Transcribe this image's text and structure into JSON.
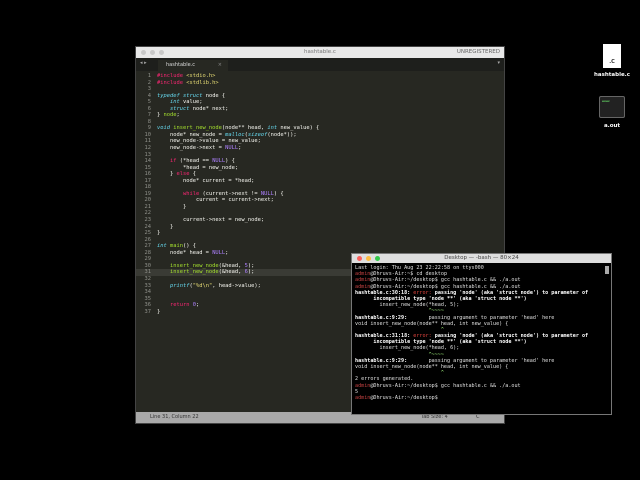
{
  "editor": {
    "title": "hashtable.c",
    "unregistered": "UNREGISTERED",
    "tab_label": "hashtable.c",
    "tab_close": "×",
    "nav": "◂ ▸",
    "tab_menu": "▾",
    "current_line": 31,
    "lines": [
      "#include <stdio.h>",
      "#include <stdlib.h>",
      "",
      "typedef struct node {",
      "    int value;",
      "    struct node* next;",
      "} node;",
      "",
      "void insert_new_node(node** head, int new_value) {",
      "    node* new_node = malloc(sizeof(node*));",
      "    new_node->value = new_value;",
      "    new_node->next = NULL;",
      "",
      "    if (*head == NULL) {",
      "        *head = new_node;",
      "    } else {",
      "        node* current = *head;",
      "",
      "        while (current->next != NULL) {",
      "            current = current->next;",
      "        }",
      "",
      "        current->next = new_node;",
      "    }",
      "}",
      "",
      "int main() {",
      "    node* head = NULL;",
      "",
      "    insert_new_node(&head, 5);",
      "    insert_new_node(&head, 6);",
      "",
      "    printf(\"%d\\n\", head->value);",
      "",
      "",
      "    return 0;",
      "}"
    ],
    "status": {
      "position": "Line 31, Column 22",
      "tab_size": "Tab Size: 4",
      "language": "C"
    }
  },
  "terminal": {
    "title": "Desktop — -bash — 80×24",
    "lines": [
      [
        [
          "",
          "Last login: Thu Aug 23 22:22:58 on ttys000"
        ]
      ],
      [
        [
          "pm",
          "admin"
        ],
        [
          "",
          "@Dhruvs-Air:~$ cd desktop"
        ]
      ],
      [
        [
          "pm",
          "admin"
        ],
        [
          "",
          "@Dhruvs-Air:~/desktop$ gcc hashtable.c && ./a.out"
        ]
      ],
      [
        [
          "pm",
          "admin"
        ],
        [
          "",
          "@Dhruvs-Air:~/desktop$ gcc hashtable.c && ./a.out"
        ]
      ],
      [
        [
          "w",
          "hashtable.c:30:18: "
        ],
        [
          "rd",
          "error: "
        ],
        [
          "w",
          "passing 'node' (aka 'struct node') to parameter of"
        ]
      ],
      [
        [
          "w",
          "      incompatible type 'node **' (aka 'struct node **')"
        ]
      ],
      [
        [
          "",
          "        insert_new_node(*head, 5);"
        ]
      ],
      [
        [
          "gn",
          "                        ^~~~~"
        ]
      ],
      [
        [
          "w",
          "hashtable.c:9:29: "
        ],
        [
          "",
          "      passing argument to parameter 'head' here"
        ]
      ],
      [
        [
          "",
          "void insert_new_node(node** head, int new_value) {"
        ]
      ],
      [
        [
          "gn",
          "                            ^"
        ]
      ],
      [
        [
          "w",
          "hashtable.c:31:18: "
        ],
        [
          "rd",
          "error: "
        ],
        [
          "w",
          "passing 'node' (aka 'struct node') to parameter of"
        ]
      ],
      [
        [
          "w",
          "      incompatible type 'node **' (aka 'struct node **')"
        ]
      ],
      [
        [
          "",
          "        insert_new_node(*head, 6);"
        ]
      ],
      [
        [
          "gn",
          "                        ^~~~~"
        ]
      ],
      [
        [
          "w",
          "hashtable.c:9:29: "
        ],
        [
          "",
          "      passing argument to parameter 'head' here"
        ]
      ],
      [
        [
          "",
          "void insert_new_node(node** head, int new_value) {"
        ]
      ],
      [
        [
          "gn",
          "                            ^"
        ]
      ],
      [
        [
          "",
          "2 errors generated."
        ]
      ],
      [
        [
          "pm",
          "admin"
        ],
        [
          "",
          "@Dhruvs-Air:~/desktop$ gcc hashtable.c && ./a.out"
        ]
      ],
      [
        [
          "",
          "5"
        ]
      ],
      [
        [
          "pm",
          "admin"
        ],
        [
          "",
          "@Dhruvs-Air:~/desktop$ "
        ]
      ]
    ]
  },
  "desktop": {
    "icons": [
      {
        "label": "hashtable.c",
        "badge": ".C"
      },
      {
        "label": "a.out",
        "badge": "exec"
      }
    ]
  }
}
